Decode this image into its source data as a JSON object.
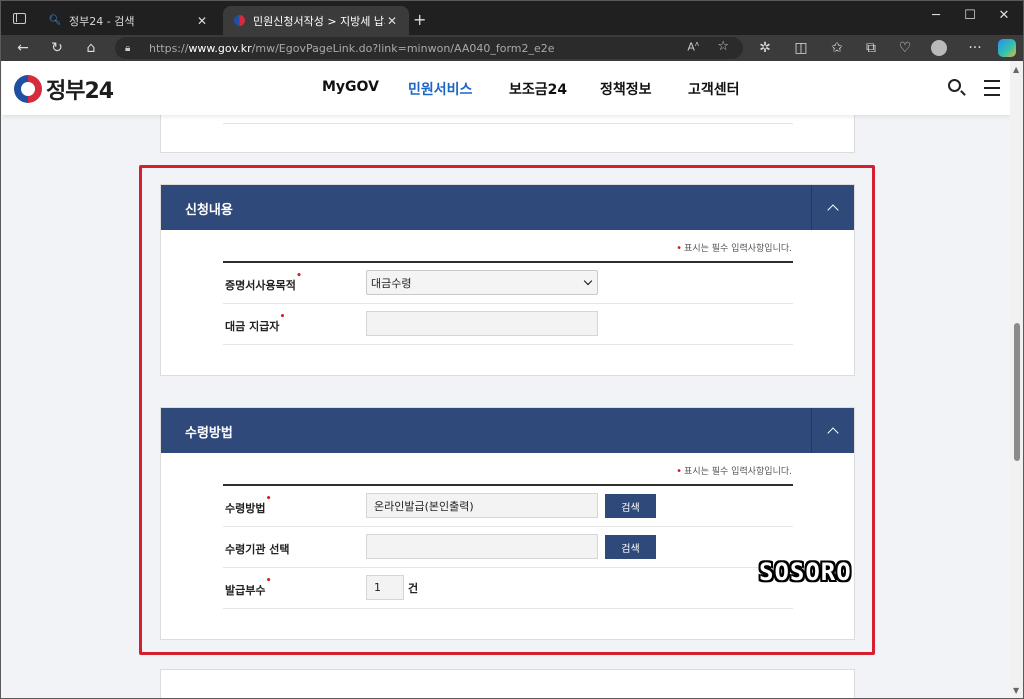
{
  "browser": {
    "tabs": [
      {
        "title": "정부24 - 검색",
        "favicon": "search-icon",
        "active": false
      },
      {
        "title": "민원신청서작성 > 지방세 납세증",
        "favicon": "gov24-favicon",
        "active": true
      }
    ],
    "url_prefix": "https://",
    "url_host": "www.gov.kr",
    "url_path": "/mw/EgovPageLink.do?link=minwon/AA040_form2_e2e",
    "window_controls": [
      "minimize",
      "maximize",
      "close"
    ]
  },
  "site": {
    "logo_text": "정부24",
    "nav": [
      {
        "label": "MyGOV",
        "active": false
      },
      {
        "label": "민원서비스",
        "active": true
      },
      {
        "label": "보조금24",
        "active": false
      },
      {
        "label": "정책정보",
        "active": false
      },
      {
        "label": "고객센터",
        "active": false
      }
    ],
    "accent_color": "#2f4a7a",
    "active_nav_color": "#1a66c8"
  },
  "sections": {
    "application": {
      "title": "신청내용",
      "required_note": "표시는 필수 입력사항입니다.",
      "fields": [
        {
          "label": "증명서사용목적",
          "required": true,
          "type": "select",
          "value": "대금수령"
        },
        {
          "label": "대금 지급자",
          "required": true,
          "type": "text",
          "value": ""
        }
      ]
    },
    "receipt": {
      "title": "수령방법",
      "required_note": "표시는 필수 입력사항입니다.",
      "fields": [
        {
          "label": "수령방법",
          "required": true,
          "type": "text",
          "value": "온라인발급(본인출력)",
          "button": "검색"
        },
        {
          "label": "수령기관 선택",
          "required": false,
          "type": "text",
          "value": "",
          "button": "검색"
        },
        {
          "label": "발급부수",
          "required": true,
          "type": "number",
          "value": "1",
          "unit": "건"
        }
      ]
    }
  },
  "overlay": {
    "watermark": "SOSORO",
    "highlight_color": "#d51f2e"
  }
}
